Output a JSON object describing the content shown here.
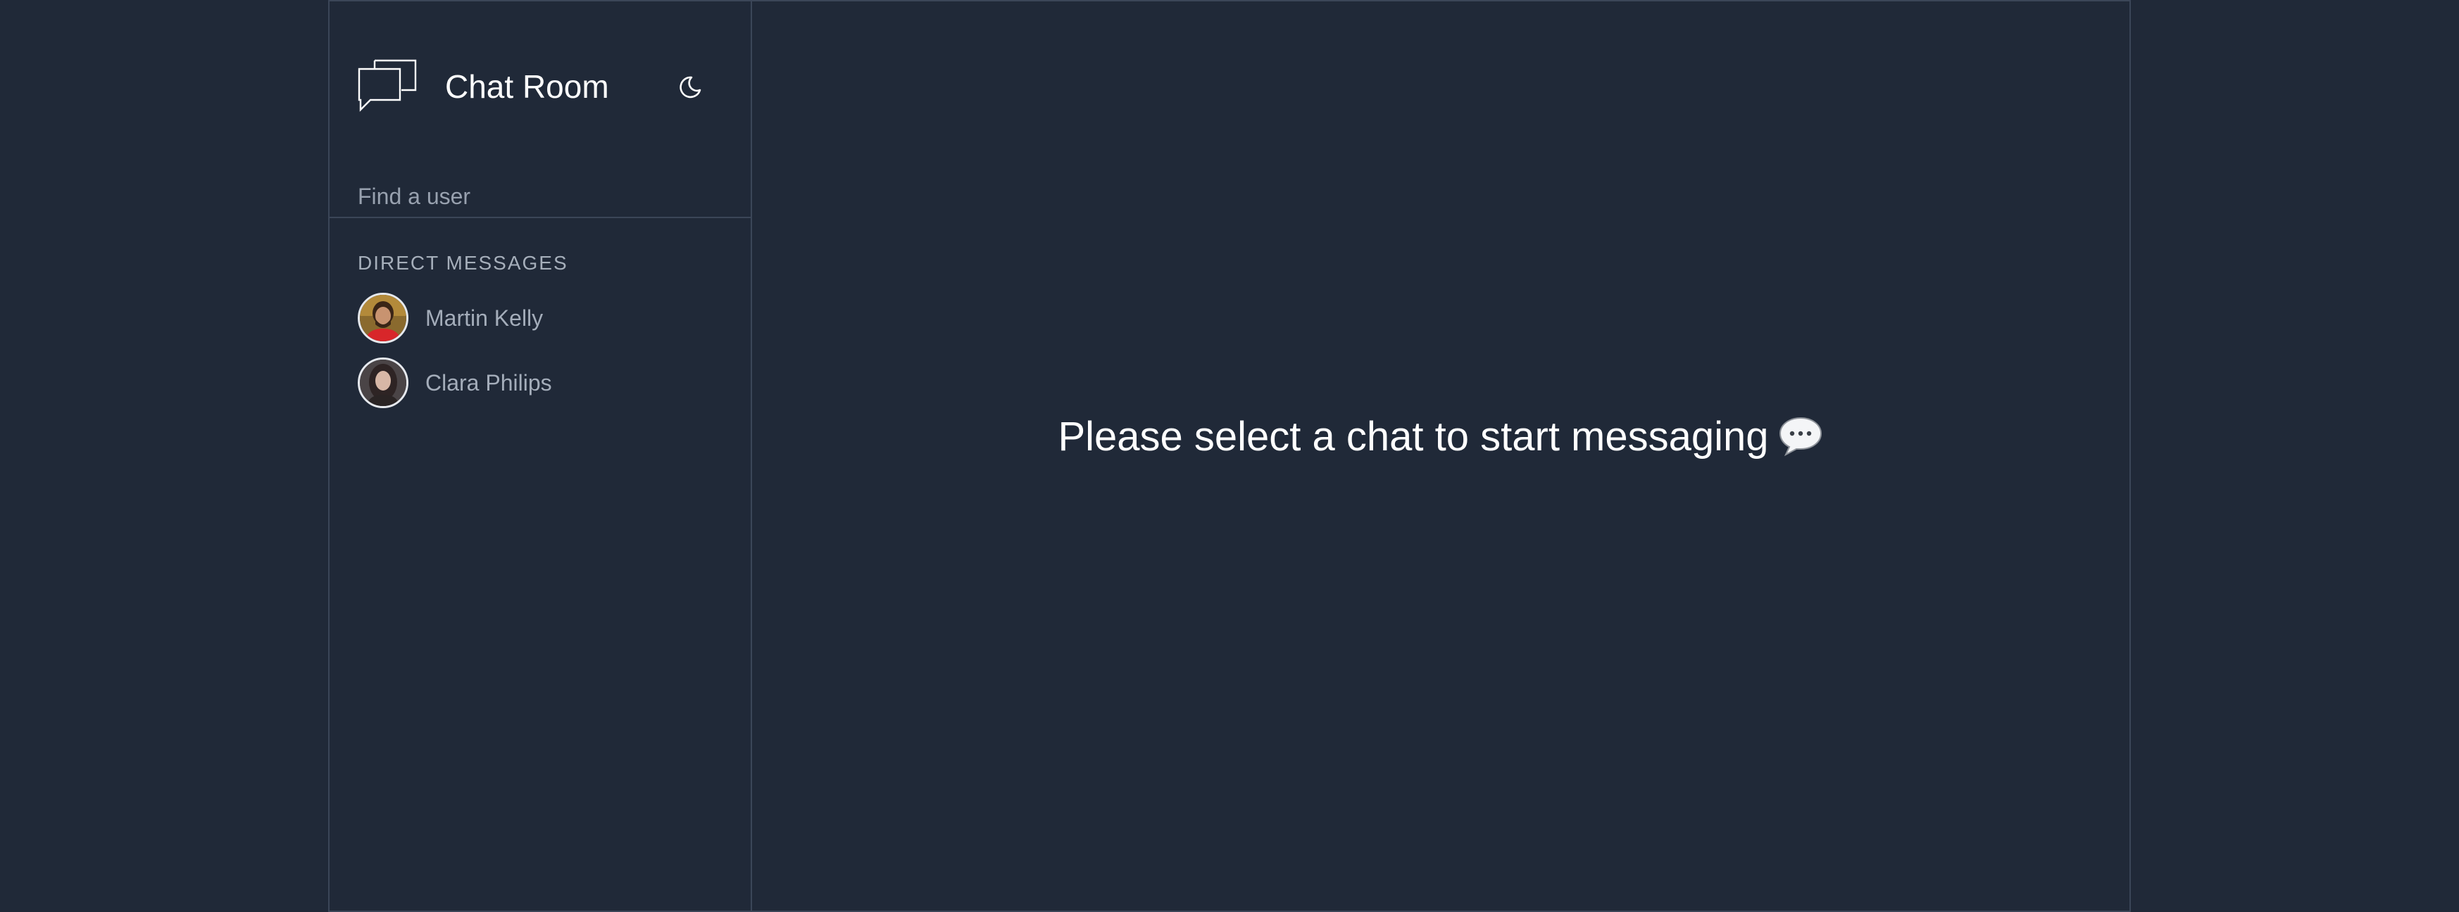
{
  "app": {
    "title": "Chat Room"
  },
  "search": {
    "placeholder": "Find a user"
  },
  "sidebar": {
    "section_heading": "DIRECT MESSAGES",
    "users": [
      {
        "name": "Martin Kelly"
      },
      {
        "name": "Clara Philips"
      }
    ]
  },
  "main": {
    "empty_message": "Please select a chat to start messaging"
  },
  "icons": {
    "brand": "chat-bubbles-icon",
    "theme_toggle": "moon-icon",
    "empty_state": "speech-bubble-icon"
  },
  "colors": {
    "background": "#202938",
    "border": "#3b4658",
    "text_primary": "#ffffff",
    "text_muted": "#a4adba"
  }
}
